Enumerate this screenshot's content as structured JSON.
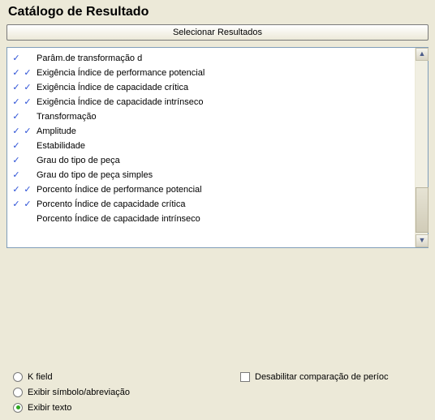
{
  "header": {
    "title": "Catálogo de Resultado",
    "select_button": "Selecionar Resultados"
  },
  "list": {
    "items": [
      {
        "c1": true,
        "c2": false,
        "label": "Parâm.de transformação d"
      },
      {
        "c1": true,
        "c2": true,
        "label": "Exigência Índice de performance potencial"
      },
      {
        "c1": true,
        "c2": true,
        "label": "Exigência Índice de capacidade crítica"
      },
      {
        "c1": true,
        "c2": true,
        "label": "Exigência Índice de capacidade intrínseco"
      },
      {
        "c1": true,
        "c2": false,
        "label": "Transformação"
      },
      {
        "c1": true,
        "c2": true,
        "label": "Amplitude"
      },
      {
        "c1": true,
        "c2": false,
        "label": "Estabilidade"
      },
      {
        "c1": true,
        "c2": false,
        "label": "Grau do tipo de peça"
      },
      {
        "c1": true,
        "c2": false,
        "label": "Grau do tipo de peça simples"
      },
      {
        "c1": true,
        "c2": true,
        "label": "Porcento Índice de performance potencial"
      },
      {
        "c1": true,
        "c2": true,
        "label": "Porcento Índice de capacidade crítica"
      },
      {
        "c1": false,
        "c2": false,
        "label": "Porcento Índice de capacidade intrínseco"
      }
    ]
  },
  "options": {
    "radios": {
      "k_field": "K field",
      "symbol": "Exibir símbolo/abreviação",
      "text": "Exibir texto"
    },
    "selected_radio": "text",
    "disable_compare": {
      "label": "Desabilitar comparação de períoc",
      "checked": false
    }
  }
}
